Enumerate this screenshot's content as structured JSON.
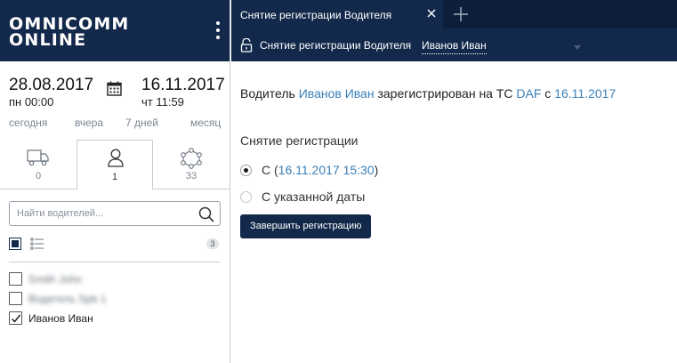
{
  "brand": {
    "line1": "OMNICOMM",
    "line2": "ONLINE"
  },
  "period": {
    "from_date": "28.08.2017",
    "from_time": "пн 00:00",
    "to_date": "16.11.2017",
    "to_time": "чт 11:59",
    "shortcuts": [
      "сегодня",
      "вчера",
      "7 дней",
      "месяц"
    ]
  },
  "object_tabs": [
    {
      "icon": "truck-icon",
      "count": "0"
    },
    {
      "icon": "person-icon",
      "count": "1"
    },
    {
      "icon": "network-icon",
      "count": "33"
    }
  ],
  "search": {
    "placeholder": "Найти водителей..."
  },
  "list": {
    "count_badge": "3"
  },
  "drivers": [
    {
      "name": "Smith John",
      "checked": false,
      "blurred": true
    },
    {
      "name": "Водитель Spb 1",
      "checked": false,
      "blurred": true
    },
    {
      "name": "Иванов Иван",
      "checked": true,
      "blurred": false
    }
  ],
  "doc_tab": {
    "label": "Снятие регистрации Водителя"
  },
  "subheader": {
    "title": "Снятие регистрации Водителя",
    "driver": "Иванов Иван"
  },
  "content": {
    "status_prefix": "Водитель ",
    "driver_link": "Иванов Иван",
    "status_middle": " зарегистрирован на ТС ",
    "vehicle_link": "DAF",
    "status_with": " с ",
    "date_link": "16.11.2017",
    "section_title": "Снятие регистрации",
    "option1_prefix": "С (",
    "option1_link": "16.11.2017 15:30",
    "option1_suffix": ")",
    "option2_label": "С указанной даты",
    "finish_button": "Завершить регистрацию"
  }
}
